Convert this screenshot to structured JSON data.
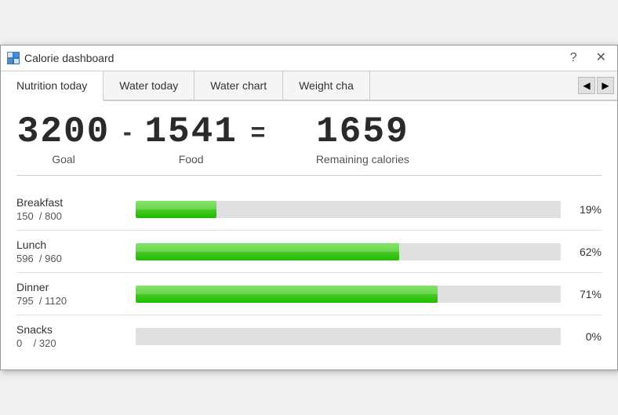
{
  "window": {
    "title": "Calorie dashboard",
    "help_btn": "?",
    "close_btn": "✕"
  },
  "tabs": [
    {
      "id": "nutrition",
      "label": "Nutrition today",
      "active": true
    },
    {
      "id": "water-today",
      "label": "Water today",
      "active": false
    },
    {
      "id": "water-chart",
      "label": "Water chart",
      "active": false
    },
    {
      "id": "weight-chart",
      "label": "Weight cha",
      "active": false
    }
  ],
  "tab_nav": {
    "prev": "◀",
    "next": "▶"
  },
  "summary": {
    "goal_value": "3200",
    "goal_label": "Goal",
    "minus": "-",
    "food_value": "1541",
    "food_label": "Food",
    "equals": "=",
    "remaining_value": "1659",
    "remaining_label": "Remaining calories"
  },
  "meals": [
    {
      "name": "Breakfast",
      "current": "150",
      "total": "800",
      "percent": 19,
      "percent_label": "19%"
    },
    {
      "name": "Lunch",
      "current": "596",
      "total": "960",
      "percent": 62,
      "percent_label": "62%"
    },
    {
      "name": "Dinner",
      "current": "795",
      "total": "1120",
      "percent": 71,
      "percent_label": "71%"
    },
    {
      "name": "Snacks",
      "current": "0",
      "total": "320",
      "percent": 0,
      "percent_label": "0%"
    }
  ],
  "colors": {
    "progress_green_start": "#66dd44",
    "progress_green_end": "#22bb00",
    "progress_bg": "#e0e0e0"
  }
}
